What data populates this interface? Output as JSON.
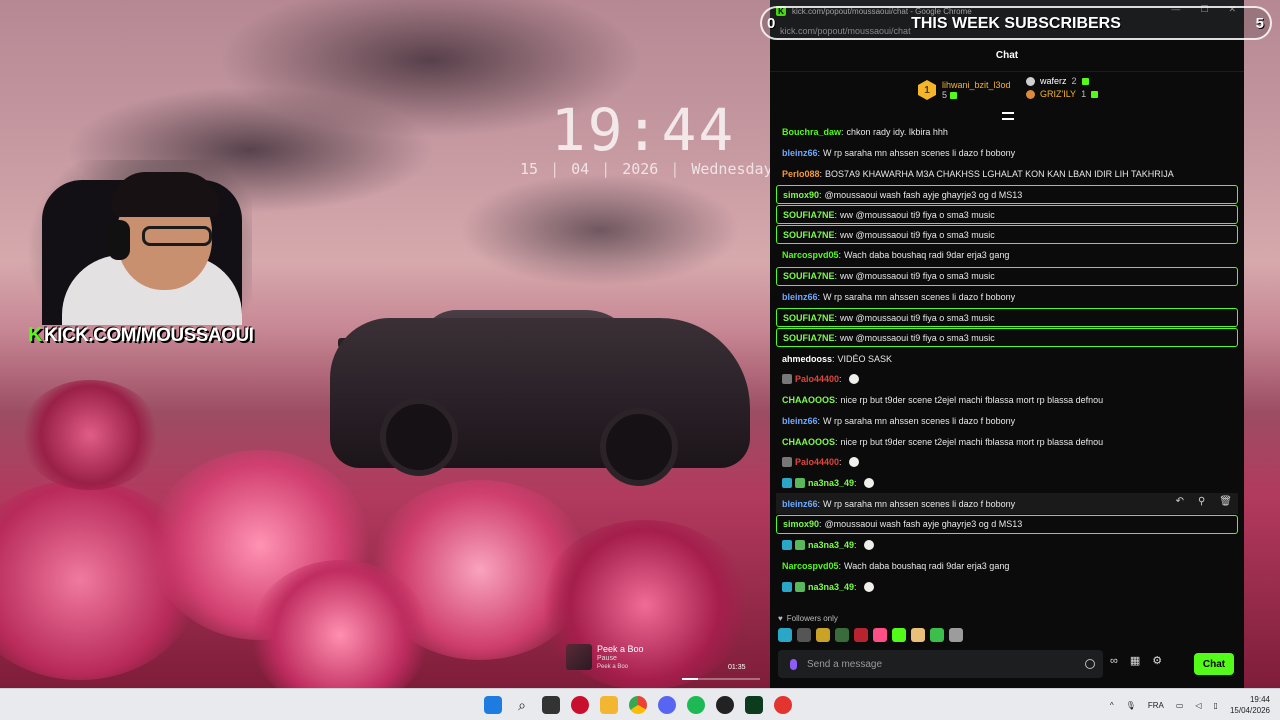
{
  "wallpaper": {
    "clock_time": "19:44",
    "date_day": "15",
    "date_month": "04",
    "date_year": "2026",
    "date_weekday": "Wednesday",
    "date_sep": "|"
  },
  "webcam": {
    "caption_logo": "K",
    "caption": "KICK.COM/MOUSSAOUI"
  },
  "music_widget": {
    "title": "Peek a Boo",
    "status": "Pause",
    "artist": "Peek a Boo",
    "time": "01:35",
    "progress": 0.2
  },
  "subs_overlay": {
    "title": "THIS WEEK SUBSCRIBERS",
    "left_count": "0",
    "right_count": "5"
  },
  "chrome": {
    "favicon": "K",
    "window_title": "kick.com/popout/moussaoui/chat - Google Chrome",
    "address": "kick.com/popout/moussaoui/chat",
    "minimize_icon": "—",
    "maximize_icon": "☐",
    "close_icon": "✕"
  },
  "chat": {
    "header": "Chat",
    "leaderboard": {
      "first": {
        "rank": "1",
        "name": "lihwani_bzit_l3od",
        "count": "5"
      },
      "others": [
        {
          "name": "waferz",
          "count": "2",
          "name_color": "#ffffff",
          "dot_color": "#cfcfcf"
        },
        {
          "name": "GRIZ'ILY",
          "count": "1",
          "name_color": "#f4b52a",
          "dot_color": "#d98a3a"
        }
      ]
    },
    "messages": [
      {
        "user": "Bouchra_daw",
        "color": "#53fc18",
        "text": "chkon rady idy. lkbira hhh",
        "hl": false,
        "badges": [],
        "emote": false
      },
      {
        "user": "bleinz66",
        "color": "#6ea8ff",
        "text": "W rp saraha mn ahssen scenes li dazo f bobony",
        "hl": false,
        "badges": [],
        "emote": false
      },
      {
        "user": "Perlo088",
        "color": "#f59b2f",
        "text": "BOS7A9 KHAWARHA M3A CHAKHSS LGHALAT KON KAN LBAN IDIR LIH TAKHRIJA",
        "hl": false,
        "badges": [],
        "emote": false
      },
      {
        "user": "simox90",
        "color": "#7cfc4a",
        "text": "@moussaoui wash fash ayje ghayrje3 og d MS13",
        "hl": true,
        "badges": [],
        "emote": false
      },
      {
        "user": "SOUFIA7NE",
        "color": "#7cfc4a",
        "text": "ww @moussaoui ti9 fiya o sma3 music",
        "hl": true,
        "badges": [],
        "emote": false
      },
      {
        "user": "SOUFIA7NE",
        "color": "#7cfc4a",
        "text": "ww @moussaoui ti9 fiya o sma3 music",
        "hl": true,
        "badges": [],
        "emote": false
      },
      {
        "user": "Narcospvd05",
        "color": "#53fc18",
        "text": "Wach daba boushaq radi 9dar erja3 gang",
        "hl": false,
        "badges": [],
        "emote": false
      },
      {
        "user": "SOUFIA7NE",
        "color": "#7cfc4a",
        "text": "ww @moussaoui ti9 fiya o sma3 music",
        "hl": true,
        "badges": [],
        "emote": false
      },
      {
        "user": "bleinz66",
        "color": "#6ea8ff",
        "text": "W rp saraha mn ahssen scenes li dazo f bobony",
        "hl": false,
        "badges": [],
        "emote": false
      },
      {
        "user": "SOUFIA7NE",
        "color": "#7cfc4a",
        "text": "ww @moussaoui ti9 fiya o sma3 music",
        "hl": true,
        "badges": [],
        "emote": false
      },
      {
        "user": "SOUFIA7NE",
        "color": "#7cfc4a",
        "text": "ww @moussaoui ti9 fiya o sma3 music",
        "hl": true,
        "badges": [],
        "emote": false
      },
      {
        "user": "ahmedooss",
        "color": "#ffffff",
        "text": "VIDÉO SASK",
        "hl": false,
        "badges": [],
        "emote": false
      },
      {
        "user": "Palo44400",
        "color": "#e0443a",
        "text": "",
        "hl": false,
        "badges": [
          "#777777"
        ],
        "emote": true
      },
      {
        "user": "CHAAOOOS",
        "color": "#7cfc4a",
        "text": "nice rp but t9der scene t2ejel machi fblassa mort rp blassa defnou",
        "hl": false,
        "badges": [],
        "emote": false
      },
      {
        "user": "bleinz66",
        "color": "#6ea8ff",
        "text": "W rp saraha mn ahssen scenes li dazo f bobony",
        "hl": false,
        "badges": [],
        "emote": false
      },
      {
        "user": "CHAAOOOS",
        "color": "#7cfc4a",
        "text": "nice rp but t9der scene t2ejel machi fblassa mort rp blassa defnou",
        "hl": false,
        "badges": [],
        "emote": false
      },
      {
        "user": "Palo44400",
        "color": "#e0443a",
        "text": "",
        "hl": false,
        "badges": [
          "#777777"
        ],
        "emote": true
      },
      {
        "user": "na3na3_49",
        "color": "#7cfc4a",
        "text": "",
        "hl": false,
        "badges": [
          "#2aa7c7",
          "#58b85a"
        ],
        "emote": true
      },
      {
        "user": "bleinz66",
        "color": "#6ea8ff",
        "text": "W rp saraha mn ahssen scenes li dazo f bobony",
        "hl": false,
        "badges": [],
        "emote": false,
        "hover": true
      },
      {
        "user": "simox90",
        "color": "#7cfc4a",
        "text": "@moussaoui wash fash ayje ghayrje3 og d MS13",
        "hl": true,
        "badges": [],
        "emote": false
      },
      {
        "user": "na3na3_49",
        "color": "#7cfc4a",
        "text": "",
        "hl": false,
        "badges": [
          "#2aa7c7",
          "#58b85a"
        ],
        "emote": true
      },
      {
        "user": "Narcospvd05",
        "color": "#53fc18",
        "text": "Wach daba boushaq radi 9dar erja3 gang",
        "hl": false,
        "badges": [],
        "emote": false
      },
      {
        "user": "na3na3_49",
        "color": "#7cfc4a",
        "text": "",
        "hl": false,
        "badges": [
          "#2aa7c7",
          "#58b85a"
        ],
        "emote": true
      }
    ],
    "hover_tools": {
      "reply_icon": "↶",
      "pin_icon": "⚲",
      "delete_icon": "🗑"
    },
    "followers_only": "Followers only",
    "composer_placeholder": "Send a message",
    "send_label": "Chat",
    "actions": {
      "infinity": "∞",
      "store_icon": "▦",
      "settings_icon": "⚙"
    }
  },
  "taskbar": {
    "language": "FRA",
    "time": "19:44",
    "date": "15/04/2026",
    "up_arrow": "^",
    "icons": [
      "windows-start",
      "search",
      "task-view",
      "app-red",
      "file-explorer",
      "chrome",
      "discord",
      "spotify",
      "app-dark",
      "app-green",
      "app-red-2"
    ]
  },
  "colors": {
    "kick_green": "#53fc18",
    "chat_bg": "#0b0b0c",
    "gold": "#f4b52a"
  }
}
